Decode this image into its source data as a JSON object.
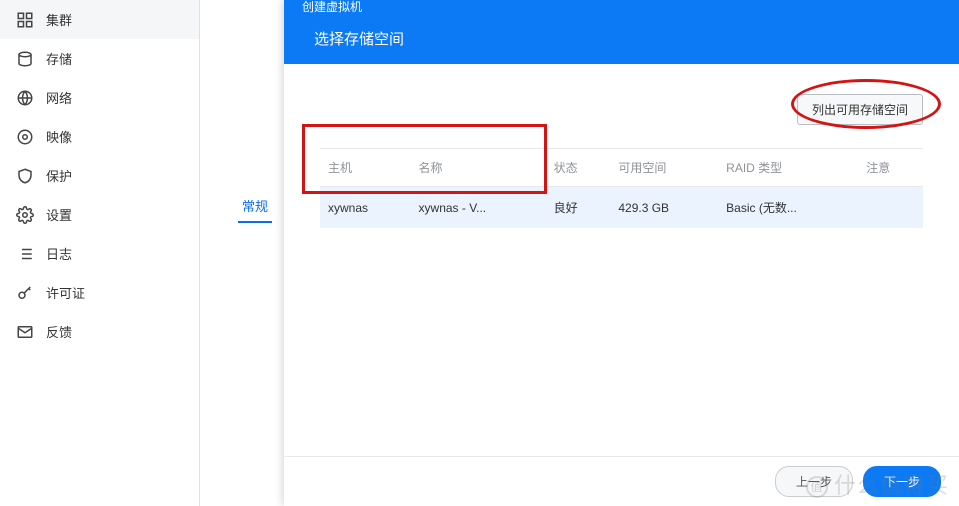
{
  "sidebar": {
    "items": [
      {
        "label": "集群",
        "icon": "cluster-icon"
      },
      {
        "label": "存储",
        "icon": "storage-icon"
      },
      {
        "label": "网络",
        "icon": "network-icon"
      },
      {
        "label": "映像",
        "icon": "image-icon"
      },
      {
        "label": "保护",
        "icon": "shield-icon"
      },
      {
        "label": "设置",
        "icon": "gear-icon"
      },
      {
        "label": "日志",
        "icon": "list-icon"
      },
      {
        "label": "许可证",
        "icon": "key-icon"
      },
      {
        "label": "反馈",
        "icon": "mail-icon"
      }
    ]
  },
  "tabbar": {
    "active": "常规"
  },
  "modal": {
    "window_title": "创建虚拟机",
    "title": "选择存储空间",
    "list_button": "列出可用存储空间",
    "table": {
      "headers": [
        "主机",
        "名称",
        "状态",
        "可用空间",
        "RAID 类型",
        "注意"
      ],
      "rows": [
        {
          "host": "xywnas",
          "name": "xywnas - V...",
          "status": "良好",
          "avail": "429.3 GB",
          "raid": "Basic (无数...",
          "note": ""
        }
      ]
    },
    "footer": {
      "prev": "上一步",
      "next": "下一步"
    }
  },
  "watermark": "什么值得买"
}
